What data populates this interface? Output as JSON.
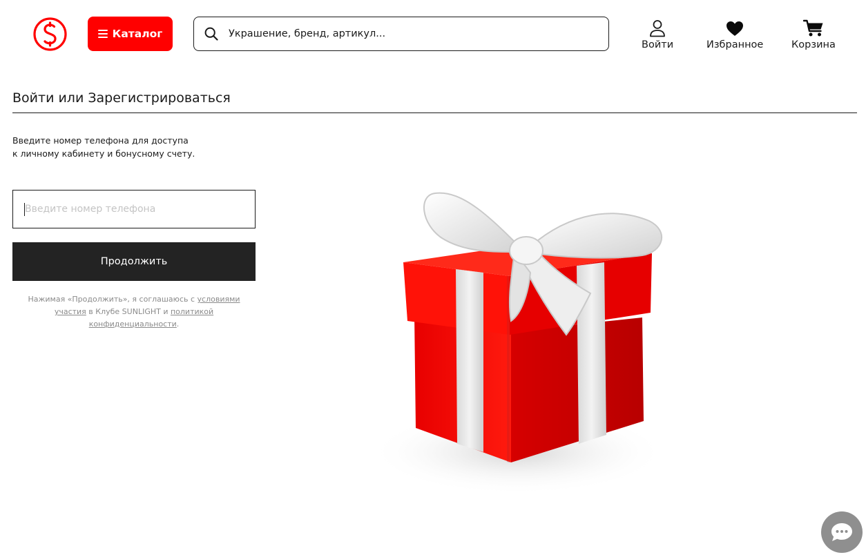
{
  "header": {
    "logo_icon": "sunlight-logo-icon",
    "catalog_label": "Каталог",
    "search": {
      "placeholder": "Украшение, бренд, артикул..."
    },
    "nav": {
      "login_label": "Войти",
      "favorites_label": "Избранное",
      "cart_label": "Корзина"
    }
  },
  "main": {
    "title": "Войти или Зарегистрироваться",
    "description_line1": "Введите номер телефона для доступа",
    "description_line2": "к личному кабинету и бонусному счету.",
    "phone_placeholder": "Введите номер телефона",
    "continue_label": "Продолжить",
    "terms": {
      "part1": "Нажимая «Продолжить», я соглашаюсь с ",
      "link1": "условиями участия",
      "part2": " в Клубе SUNLIGHT и ",
      "link2": "политикой конфиденциальности",
      "part3": "."
    }
  },
  "colors": {
    "accent": "#ff0000",
    "button_dark": "#232323",
    "chat_button": "#8f8f8f"
  }
}
